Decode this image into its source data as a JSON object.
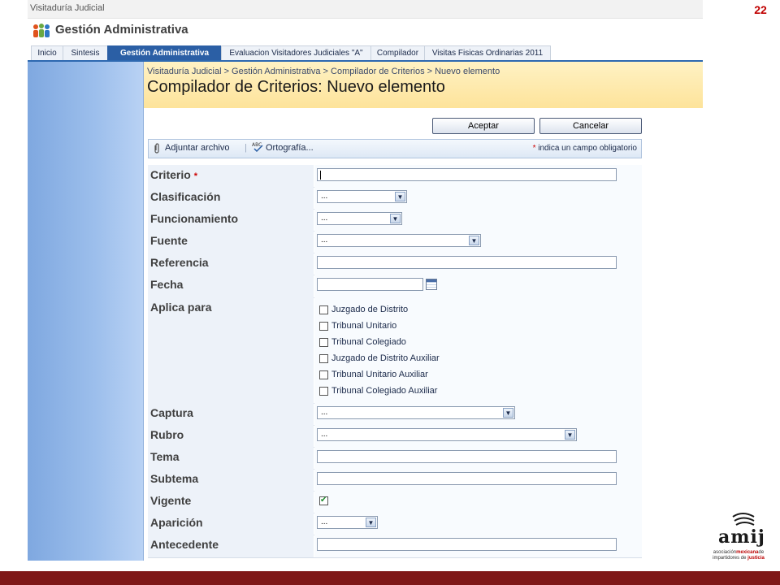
{
  "slide": {
    "number": "22"
  },
  "site": {
    "name": "Visitaduría Judicial"
  },
  "app": {
    "title": "Gestión Administrativa"
  },
  "tabs": [
    {
      "label": "Inicio"
    },
    {
      "label": "Sintesis"
    },
    {
      "label": "Gestión Administrativa",
      "active": true
    },
    {
      "label": "Evaluacion Visitadores Judiciales \"A\""
    },
    {
      "label": "Compilador"
    },
    {
      "label": "Visitas Fisicas Ordinarias 2011"
    }
  ],
  "header": {
    "breadcrumb": "Visitaduría Judicial > Gestión Administrativa > Compilador de Criterios > Nuevo elemento",
    "title": "Compilador de Criterios: Nuevo elemento"
  },
  "buttons": {
    "accept": "Aceptar",
    "cancel": "Cancelar"
  },
  "toolbar": {
    "attach": "Adjuntar archivo",
    "spelling": "Ortografía...",
    "required_star": "*",
    "required_note": "indica un campo obligatorio"
  },
  "form": {
    "criterio": {
      "label": "Criterio",
      "required_star": "*",
      "value": ""
    },
    "clasificacion": {
      "label": "Clasificación",
      "value": "..."
    },
    "funcionamiento": {
      "label": "Funcionamiento",
      "value": "..."
    },
    "fuente": {
      "label": "Fuente",
      "value": "..."
    },
    "referencia": {
      "label": "Referencia",
      "value": ""
    },
    "fecha": {
      "label": "Fecha",
      "value": ""
    },
    "aplica_para": {
      "label": "Aplica para",
      "options": [
        {
          "label": "Juzgado de Distrito",
          "checked": false
        },
        {
          "label": "Tribunal Unitario",
          "checked": false
        },
        {
          "label": "Tribunal Colegiado",
          "checked": false
        },
        {
          "label": "Juzgado de Distrito Auxiliar",
          "checked": false
        },
        {
          "label": "Tribunal Unitario Auxiliar",
          "checked": false
        },
        {
          "label": "Tribunal Colegiado Auxiliar",
          "checked": false
        }
      ]
    },
    "captura": {
      "label": "Captura",
      "value": "..."
    },
    "rubro": {
      "label": "Rubro",
      "value": "..."
    },
    "tema": {
      "label": "Tema",
      "value": ""
    },
    "subtema": {
      "label": "Subtema",
      "value": ""
    },
    "vigente": {
      "label": "Vigente",
      "checked": true
    },
    "aparicion": {
      "label": "Aparición",
      "value": "..."
    },
    "antecedente": {
      "label": "Antecedente",
      "value": ""
    }
  },
  "logo": {
    "name": "amij",
    "line1_prefix": "asociación",
    "line1_highlight": "mexicana",
    "line1_suffix": "de",
    "line2_prefix": "impartidores",
    "line2_mid": "de",
    "line2_highlight": "justicia"
  },
  "colors": {
    "tab_active": "#2b5fa5",
    "header_bg": "#fde39a",
    "left_nav": "#9dbfec",
    "footer_bar": "#7f1818",
    "slide_number": "#c00000"
  }
}
